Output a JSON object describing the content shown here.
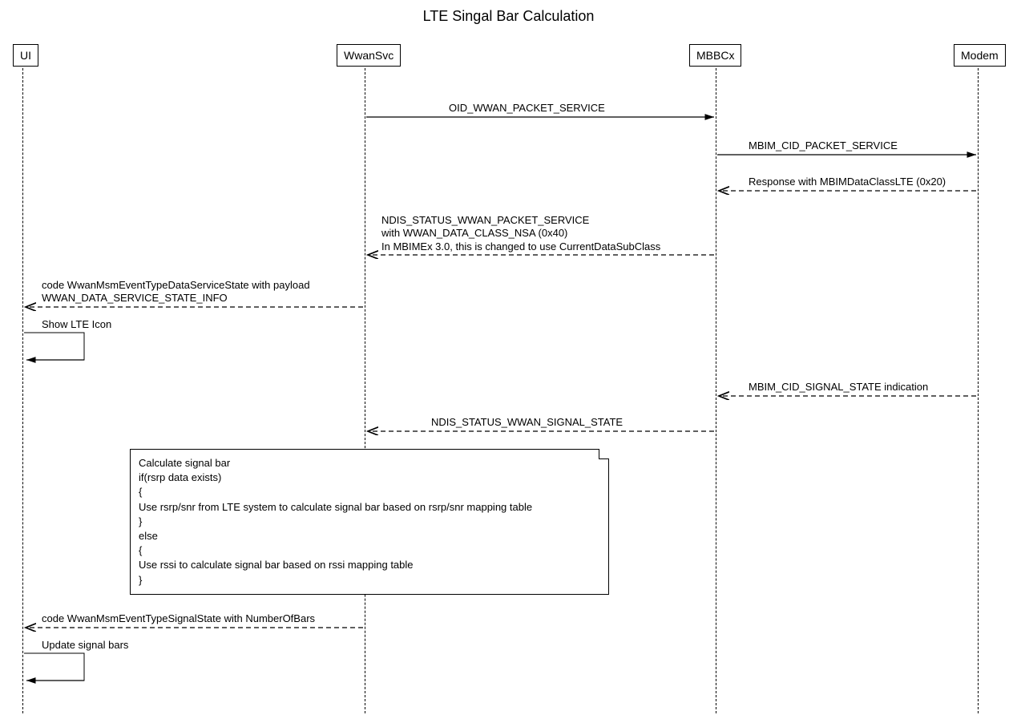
{
  "title": "LTE Singal Bar Calculation",
  "actors": {
    "ui": "UI",
    "wwansvc": "WwanSvc",
    "mbbcx": "MBBCx",
    "modem": "Modem"
  },
  "messages": {
    "m1": "OID_WWAN_PACKET_SERVICE",
    "m2": "MBIM_CID_PACKET_SERVICE",
    "m3": "Response with MBIMDataClassLTE (0x20)",
    "m4": "NDIS_STATUS_WWAN_PACKET_SERVICE\nwith WWAN_DATA_CLASS_NSA (0x40)\nIn MBIMEx 3.0, this is changed to use CurrentDataSubClass",
    "m5": "code WwanMsmEventTypeDataServiceState with payload\nWWAN_DATA_SERVICE_STATE_INFO",
    "m6": "Show LTE Icon",
    "m7": "MBIM_CID_SIGNAL_STATE indication",
    "m8": "NDIS_STATUS_WWAN_SIGNAL_STATE",
    "m9": "code WwanMsmEventTypeSignalState with NumberOfBars",
    "m10": "Update signal bars"
  },
  "note": "Calculate signal bar\nif(rsrp data exists)\n{\n  Use rsrp/snr from LTE system to calculate signal bar based on rsrp/snr mapping table\n}\nelse\n{\n  Use rssi to calculate signal bar based on rssi mapping table\n}"
}
